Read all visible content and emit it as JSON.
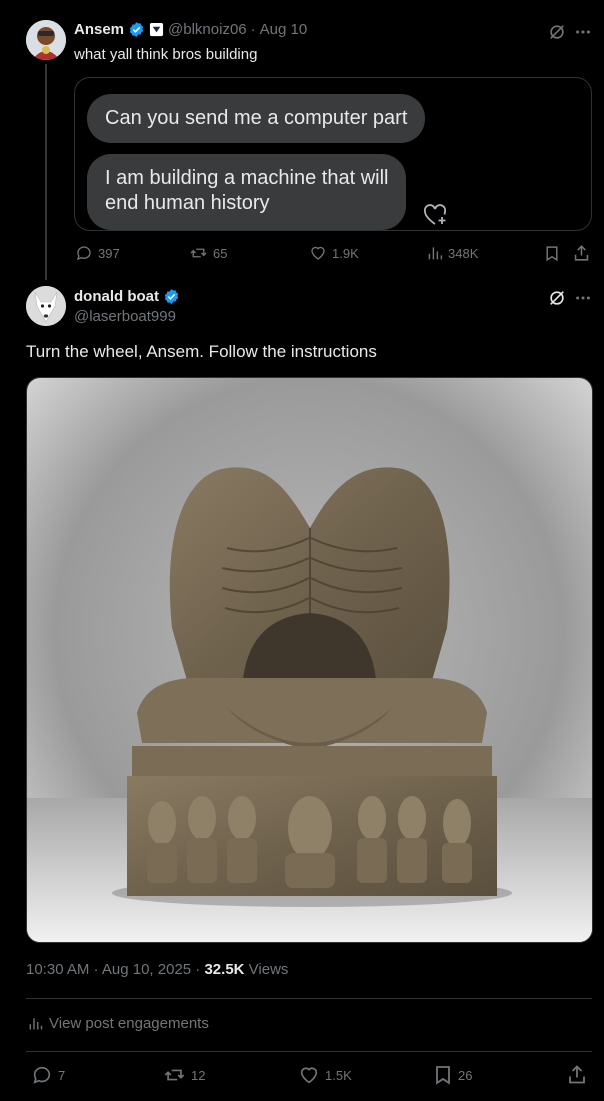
{
  "quoted_post": {
    "author_name": "Ansem",
    "handle": "@blknoiz06",
    "separator": "·",
    "date": "Aug 10",
    "text": "what yall think bros building",
    "chat": {
      "message_1": "Can you send me a computer part",
      "message_2_line_1": "I am building a machine that will",
      "message_2_line_2": "end human history"
    },
    "stats": {
      "replies": "397",
      "reposts": "65",
      "likes": "1.9K",
      "views": "348K"
    }
  },
  "main_post": {
    "author_name": "donald boat",
    "handle": "@laserboat999",
    "text": "Turn the wheel, Ansem. Follow the instructions",
    "image_alt": "Stone sculpture of a fasting seated figure on a carved pedestal",
    "timestamp": "10:30 AM · Aug 10, 2025",
    "dot": "·",
    "views_count": "32.5K",
    "views_label": "Views",
    "engagements_link": "View post engagements",
    "stats": {
      "replies": "7",
      "reposts": "12",
      "likes": "1.5K",
      "bookmarks": "26"
    }
  },
  "colors": {
    "background": "#000000",
    "text": "#e7e9ea",
    "muted": "#71767b",
    "verified": "#1d9bf0",
    "divider": "#2f3336"
  },
  "icons": [
    "grok-icon",
    "more-icon",
    "reply-icon",
    "repost-icon",
    "like-icon",
    "views-icon",
    "bookmark-icon",
    "share-icon",
    "verified-badge-icon",
    "affiliate-badge-icon",
    "like-plus-icon",
    "engagements-icon"
  ]
}
